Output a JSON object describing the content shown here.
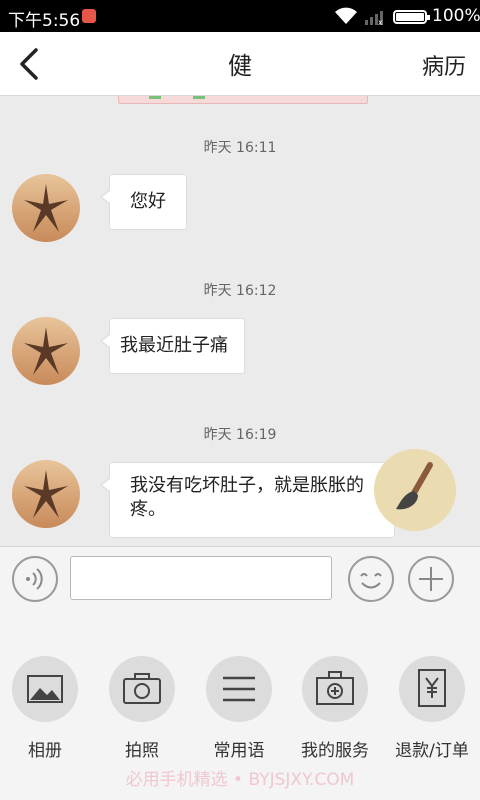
{
  "status_bar": {
    "time": "下午5:56",
    "battery": "100%"
  },
  "header": {
    "title": "健",
    "right_label": "病历"
  },
  "messages": [
    {
      "timestamp": "昨天 16:11",
      "text": "您好"
    },
    {
      "timestamp": "昨天 16:12",
      "text": "我最近肚子痛"
    },
    {
      "timestamp": "昨天 16:19",
      "text": "我没有吃坏肚子，就是胀胀的疼。"
    }
  ],
  "input": {
    "value": "",
    "placeholder": ""
  },
  "tools": [
    {
      "label": "相册",
      "icon": "album-icon"
    },
    {
      "label": "拍照",
      "icon": "camera-icon"
    },
    {
      "label": "常用语",
      "icon": "menu-lines-icon"
    },
    {
      "label": "我的服务",
      "icon": "medical-kit-icon"
    },
    {
      "label": "退款/订单",
      "icon": "yen-receipt-icon"
    }
  ],
  "watermark": "必用手机精选 • BYJSJXY.COM",
  "colors": {
    "status_bar": "#000000",
    "chat_bg": "#ebebeb",
    "bubble_bg": "#ffffff",
    "tool_circle": "#dcdcdc",
    "brush_button": "#eadbb0"
  }
}
